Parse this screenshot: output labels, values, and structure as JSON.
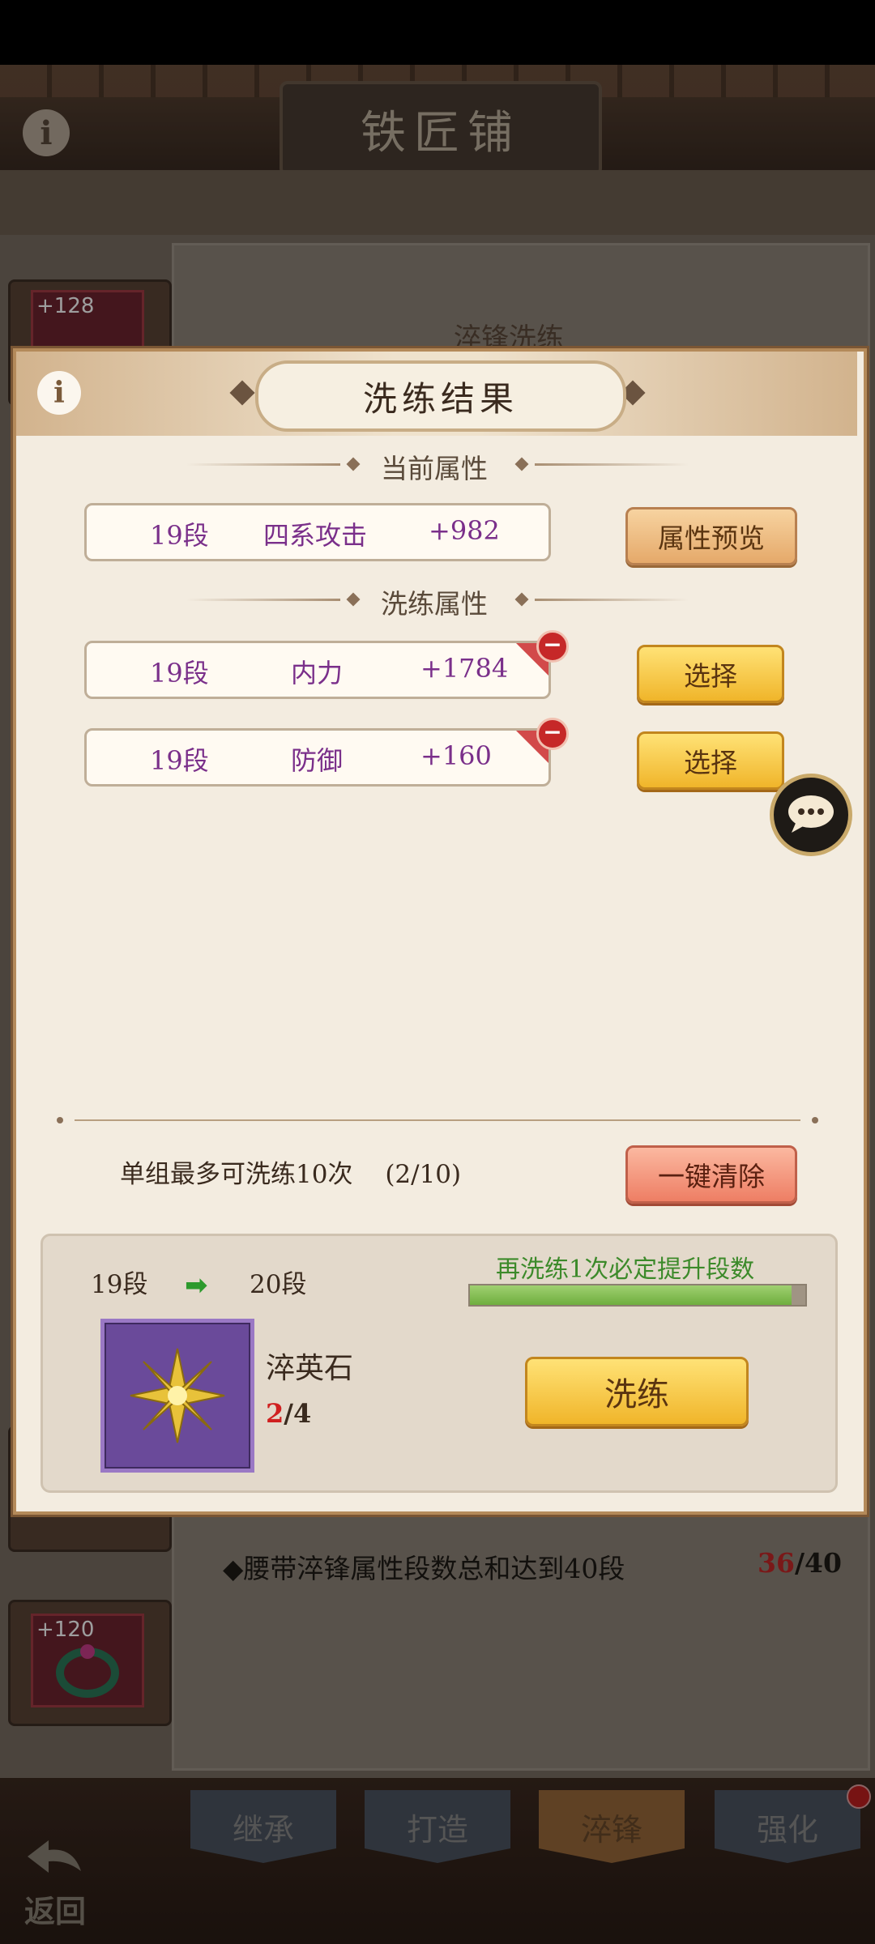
{
  "app": {
    "title": "铁匠铺"
  },
  "background": {
    "section_title": "淬锋洗练",
    "slot_levels": [
      "+128",
      "+120"
    ],
    "requirement": {
      "text": "◆腰带淬锋属性段数总和达到40段",
      "current": "36",
      "separator": "/",
      "target": "40"
    },
    "nav_tabs": [
      "继承",
      "打造",
      "淬锋",
      "强化"
    ],
    "active_tab": "淬锋",
    "back_label": "返回"
  },
  "dialog": {
    "title": "洗练结果",
    "current_section_label": "当前属性",
    "current_attribute": {
      "stage": "19段",
      "name": "四系攻击",
      "value": "+982"
    },
    "preview_button": "属性预览",
    "refine_section_label": "洗练属性",
    "refined_attributes": [
      {
        "stage": "19段",
        "name": "内力",
        "value": "+1784",
        "select_label": "选择"
      },
      {
        "stage": "19段",
        "name": "防御",
        "value": "+160",
        "select_label": "选择"
      }
    ],
    "limit_text": "单组最多可洗练10次",
    "limit_count": "(2/10)",
    "clear_button": "一键清除",
    "upgrade": {
      "from_level": "19段",
      "to_level": "20段",
      "promo_text": "再洗练1次必定提升段数",
      "progress_fraction": 0.96
    },
    "material": {
      "name": "淬英石",
      "have": "2",
      "separator": "/",
      "need": "4"
    },
    "refine_button": "洗练"
  },
  "colors": {
    "accent_gold": "#f0b52a",
    "attr_text": "#7a2f8a",
    "promo_green": "#3c8a2a",
    "warn_red": "#c62828"
  }
}
